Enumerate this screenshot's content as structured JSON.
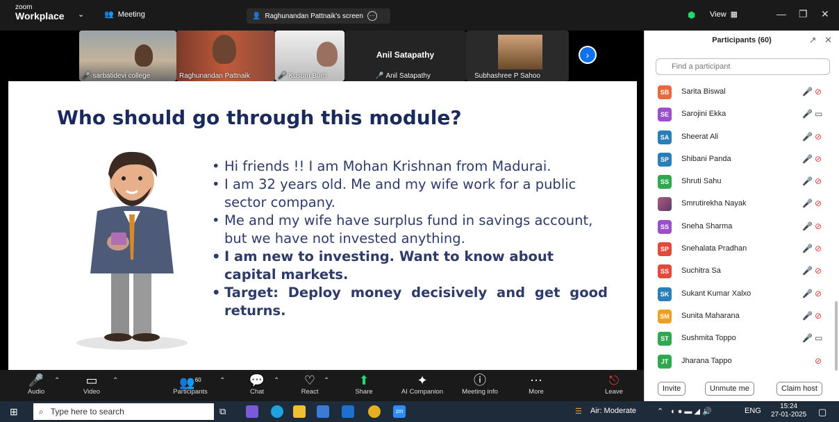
{
  "titlebar": {
    "logo_line1": "zoom",
    "logo_line2": "Workplace",
    "meeting_label": "Meeting",
    "share_label": "Raghunandan Pattnaik's screen",
    "view_label": "View"
  },
  "video_tiles": [
    {
      "name": "sarbatidevi college",
      "muted": true
    },
    {
      "name": "Raghunandan Pattnaik",
      "muted": false
    },
    {
      "name": "Kusum Burh",
      "muted": true
    },
    {
      "name": "Anil Satapathy",
      "muted": true,
      "big_name": "Anil Satapathy"
    },
    {
      "name": "Subhashree P Sahoo",
      "muted": false
    }
  ],
  "slide": {
    "title": "Who should go through this module?",
    "bullets": [
      "Hi friends !! I am Mohan Krishnan from Madurai.",
      "I am 32 years old. Me and my wife work for a public sector company.",
      "Me and my wife have surplus fund in savings account, but we have not invested anything.",
      "I am new to investing. Want to know about capital markets.",
      "Target: Deploy money decisively and get good returns."
    ]
  },
  "toolbar": {
    "audio": "Audio",
    "video": "Video",
    "participants": "Participants",
    "participants_count": "60",
    "chat": "Chat",
    "react": "React",
    "share": "Share",
    "ai_companion": "AI Companion",
    "meeting_info": "Meeting info",
    "more": "More",
    "leave": "Leave"
  },
  "panel": {
    "title": "Participants (60)",
    "search_placeholder": "Find a participant",
    "participants": [
      {
        "initials": "SB",
        "name": "Sarita Biswal",
        "color": "#e8693a",
        "cam": "off"
      },
      {
        "initials": "SE",
        "name": "Sarojini Ekka",
        "color": "#9b4fc9",
        "cam": "on"
      },
      {
        "initials": "SA",
        "name": "Sheerat Ali",
        "color": "#2a7fb8",
        "cam": "off"
      },
      {
        "initials": "SP",
        "name": "Shibani Panda",
        "color": "#2a7fb8",
        "cam": "off"
      },
      {
        "initials": "SS",
        "name": "Shruti Sahu",
        "color": "#2fa84f",
        "cam": "off"
      },
      {
        "initials": "",
        "name": "Smrutirekha Nayak",
        "color": "#b05a7a",
        "cam": "off"
      },
      {
        "initials": "SS",
        "name": "Sneha Sharma",
        "color": "#9b4fc9",
        "cam": "off"
      },
      {
        "initials": "SP",
        "name": "Snehalata Pradhan",
        "color": "#e24a3b",
        "cam": "off"
      },
      {
        "initials": "SS",
        "name": "Suchitra Sa",
        "color": "#e24a3b",
        "cam": "off"
      },
      {
        "initials": "SK",
        "name": "Sukant Kumar Xalxo",
        "color": "#2a7fb8",
        "cam": "off"
      },
      {
        "initials": "SM",
        "name": "Sunita Maharana",
        "color": "#f0a020",
        "cam": "off"
      },
      {
        "initials": "ST",
        "name": "Sushmita Toppo",
        "color": "#2fa84f",
        "cam": "on"
      },
      {
        "initials": "JT",
        "name": "Jharana Tappo",
        "color": "#2fa84f",
        "cam": "off",
        "host": true
      }
    ],
    "invite": "Invite",
    "unmute_me": "Unmute me",
    "claim_host": "Claim host"
  },
  "taskbar": {
    "search_placeholder": "Type here to search",
    "weather": "Air: Moderate",
    "lang": "ENG",
    "time": "15:24",
    "date": "27-01-2025"
  }
}
